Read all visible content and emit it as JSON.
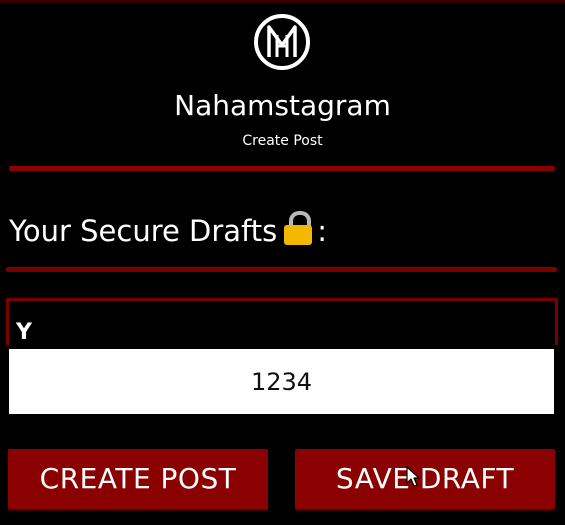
{
  "app": {
    "title": "Nahamstagram",
    "subtitle": "Create Post",
    "logo_icon": "monogram-logo-icon"
  },
  "drafts": {
    "label": "Your Secure Drafts",
    "label_suffix": ":",
    "lock_icon": "lock-icon",
    "box_peek_text": "Y"
  },
  "passcode": {
    "value": "1234"
  },
  "buttons": {
    "create_label": "CREATE POST",
    "save_label": "SAVE DRAFT"
  },
  "colors": {
    "background": "#000000",
    "accent": "#8b0000",
    "input_background": "#ffffff",
    "lock": "#f5b800"
  }
}
